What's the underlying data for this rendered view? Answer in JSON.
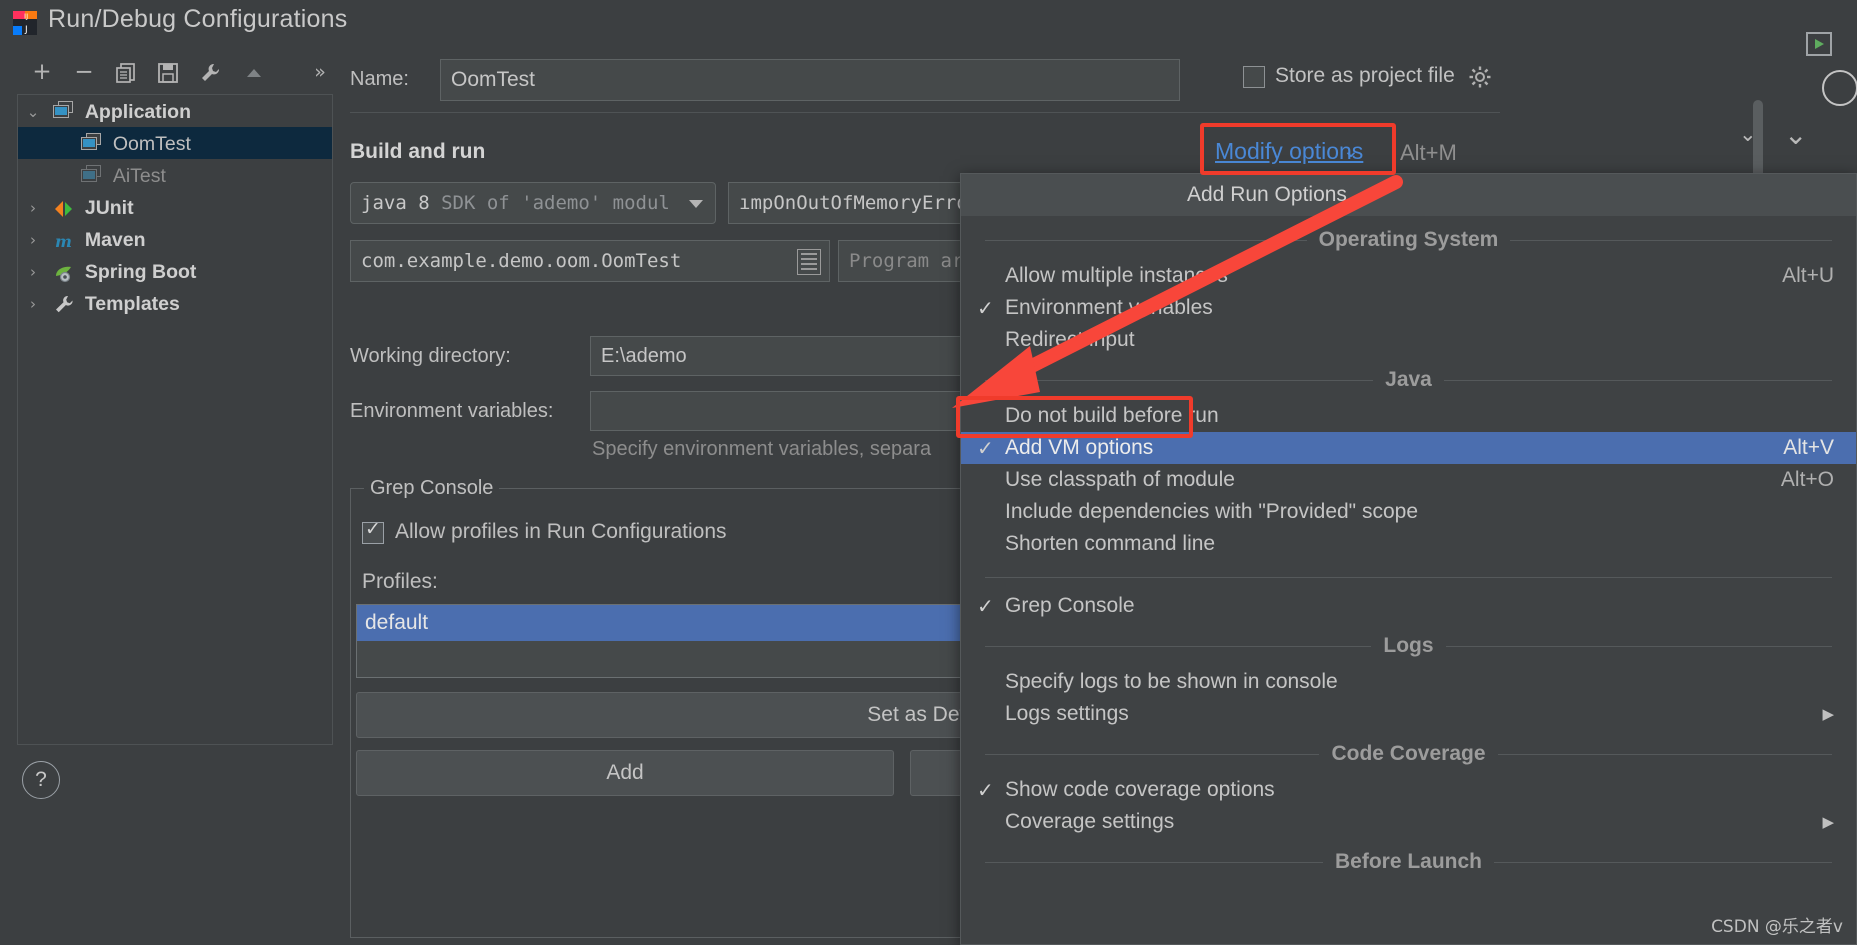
{
  "window": {
    "title": "Run/Debug Configurations",
    "close_icon": "✕",
    "app_icon": "intellij-idea-icon"
  },
  "toolbar": {
    "add": "+",
    "remove": "−",
    "copy": "⧉",
    "save": "🖫",
    "edit_templates": "🔧",
    "move_up": "▲",
    "more": "»"
  },
  "tree": {
    "items": [
      {
        "label": "Application",
        "type": "group",
        "expanded": true,
        "twisty": "⌄",
        "icon": "application-icon",
        "selected": false
      },
      {
        "label": "OomTest",
        "type": "config",
        "icon": "application-icon",
        "selected": true
      },
      {
        "label": "AiTest",
        "type": "config",
        "icon": "application-icon",
        "selected": false,
        "dim": true
      },
      {
        "label": "JUnit",
        "type": "group",
        "expanded": false,
        "twisty": "›",
        "icon": "junit-icon",
        "selected": false
      },
      {
        "label": "Maven",
        "type": "group",
        "expanded": false,
        "twisty": "›",
        "icon": "maven-icon",
        "selected": false
      },
      {
        "label": "Spring Boot",
        "type": "group",
        "expanded": false,
        "twisty": "›",
        "icon": "spring-boot-icon",
        "selected": false
      },
      {
        "label": "Templates",
        "type": "group",
        "expanded": false,
        "twisty": "›",
        "icon": "wrench-icon",
        "selected": false
      }
    ]
  },
  "help": {
    "label": "?"
  },
  "form": {
    "name_label": "Name:",
    "name_value": "OomTest",
    "store_as_project_file_label": "Store as project file",
    "store_gear_icon": "gear-icon",
    "section_title": "Build and run",
    "sdk_value_bold": "java 8",
    "sdk_value_rest": "SDK of 'ademo' modul",
    "vm_options_value": "ımpOnOutOfMemoryErro",
    "main_class_value": "com.example.demo.oom.OomTest",
    "program_args_placeholder": "Program ar",
    "working_directory_label": "Working directory:",
    "working_directory_value": "E:\\ademo",
    "environment_variables_label": "Environment variables:",
    "environment_variables_value": "",
    "environment_hint": "Specify environment variables, separa",
    "modify_options_label": "Modify options",
    "modify_options_caret": "⌄",
    "modify_options_shortcut": "Alt+M"
  },
  "grep_console": {
    "legend": "Grep Console",
    "allow_profiles_label": "Allow profiles in Run Configurations",
    "allow_profiles_checked": true,
    "profiles_label": "Profiles:",
    "profiles": [
      {
        "label": "default",
        "selected": true
      }
    ],
    "set_as_default_label": "Set as Defau",
    "add_label": "Add",
    "add2_label": ""
  },
  "menu": {
    "header": "Add Run Options",
    "groups": [
      {
        "caption": "Operating System",
        "items": [
          {
            "label": "Allow multiple instances",
            "checked": false,
            "shortcut": "Alt+U",
            "selected": false
          },
          {
            "label": "Environment variables",
            "checked": true,
            "shortcut": "",
            "selected": false
          },
          {
            "label": "Redirect input",
            "checked": false,
            "shortcut": "",
            "selected": false
          }
        ]
      },
      {
        "caption": "Java",
        "items": [
          {
            "label": "Do not build before run",
            "checked": false,
            "shortcut": "",
            "selected": false
          },
          {
            "label": "Add VM options",
            "checked": true,
            "shortcut": "Alt+V",
            "selected": true
          },
          {
            "label": "Use classpath of module",
            "checked": false,
            "shortcut": "Alt+O",
            "selected": false
          },
          {
            "label": "Include dependencies with \"Provided\" scope",
            "checked": false,
            "shortcut": "",
            "selected": false
          },
          {
            "label": "Shorten command line",
            "checked": false,
            "shortcut": "",
            "selected": false
          }
        ]
      },
      {
        "caption": "",
        "items": [
          {
            "label": "Grep Console",
            "checked": true,
            "shortcut": "",
            "selected": false
          }
        ]
      },
      {
        "caption": "Logs",
        "items": [
          {
            "label": "Specify logs to be shown in console",
            "checked": false,
            "shortcut": "",
            "selected": false
          },
          {
            "label": "Logs settings",
            "checked": false,
            "shortcut": "",
            "submenu": true,
            "selected": false
          }
        ]
      },
      {
        "caption": "Code Coverage",
        "items": [
          {
            "label": "Show code coverage options",
            "checked": true,
            "shortcut": "",
            "selected": false
          },
          {
            "label": "Coverage settings",
            "checked": false,
            "shortcut": "",
            "submenu": true,
            "selected": false
          }
        ]
      },
      {
        "caption": "Before Launch",
        "items": []
      }
    ]
  },
  "annotations": {
    "highlight_color": "#f03b2b",
    "arrow": "red-arrow-pointing-to-add-vm-options"
  },
  "watermark": "CSDN @乐之者v",
  "colors": {
    "background": "#3c3f41",
    "selection_blue": "#4b6eaf",
    "tree_selection": "#0d293e",
    "link_blue": "#4a88d6",
    "accent_red": "#f03b2b"
  }
}
